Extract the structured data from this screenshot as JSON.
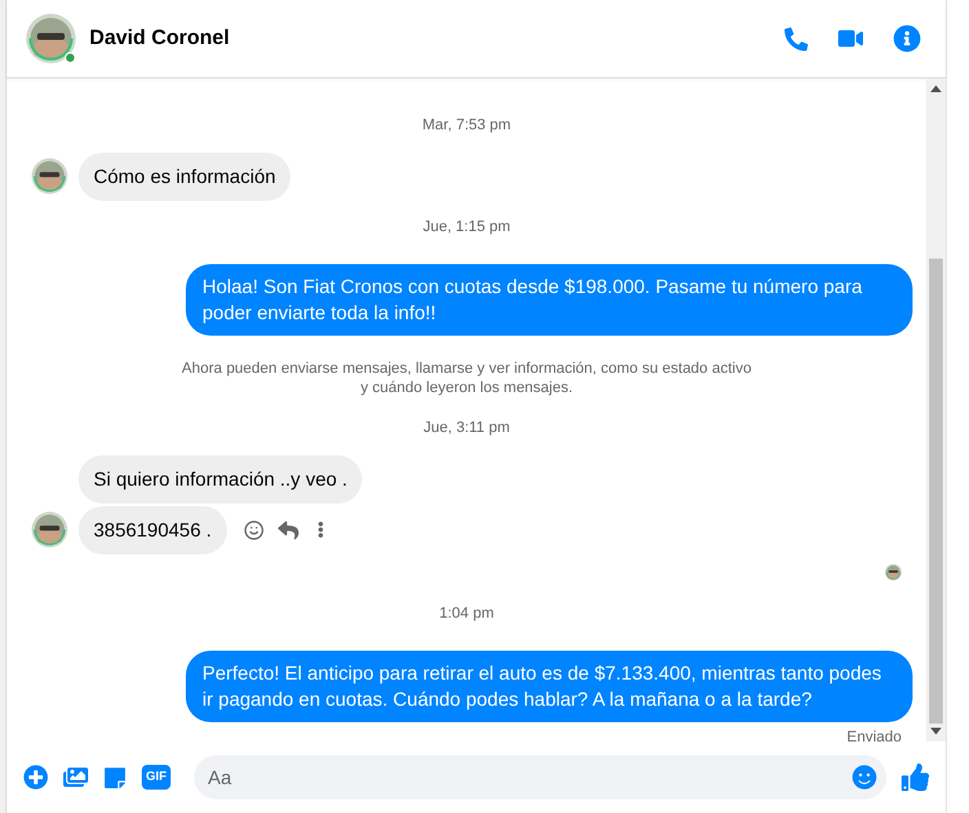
{
  "contact": {
    "name": "David Coronel",
    "online": true
  },
  "messages": [
    {
      "kind": "timestamp",
      "text": "Mar, 7:53 pm"
    },
    {
      "kind": "incoming",
      "text": "Cómo es información",
      "avatar": true,
      "actions": false
    },
    {
      "kind": "timestamp",
      "text": "Jue, 1:15 pm"
    },
    {
      "kind": "outgoing",
      "text": "Holaa! Son Fiat Cronos con cuotas desde $198.000. Pasame tu número para poder enviarte toda la info!!"
    },
    {
      "kind": "notice",
      "text": "Ahora pueden enviarse mensajes, llamarse y ver información, como su estado activo y cuándo leyeron los mensajes."
    },
    {
      "kind": "timestamp",
      "text": "Jue, 3:11 pm"
    },
    {
      "kind": "incoming",
      "text": "Si quiero información ..y veo .",
      "avatar": false,
      "actions": false
    },
    {
      "kind": "incoming",
      "text": "3856190456 .",
      "avatar": true,
      "actions": true
    },
    {
      "kind": "seen"
    },
    {
      "kind": "timestamp",
      "text": "1:04 pm"
    },
    {
      "kind": "outgoing",
      "text": "Perfecto! El anticipo para retirar el auto es de $7.133.400, mientras tanto podes ir pagando en cuotas. Cuándo podes hablar? A la mañana o a la tarde?"
    },
    {
      "kind": "status",
      "text": "Enviado"
    }
  ],
  "composer": {
    "placeholder": "Aa",
    "gif": "GIF"
  }
}
